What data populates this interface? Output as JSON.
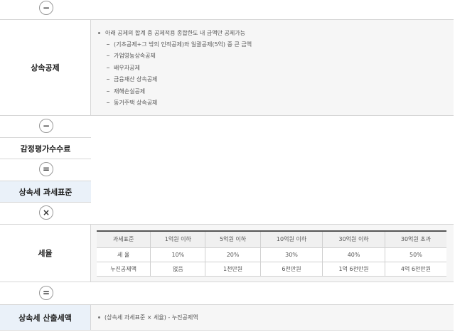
{
  "operators": {
    "minus1": "−",
    "minus2": "−",
    "equals1": "=",
    "times": "×",
    "equals2": "="
  },
  "inheritance_deduction": {
    "label": "상속공제",
    "main_bullet": "아래 공제의 합계 중 공제적용 종합한도 내 금액만 공제가능",
    "sub_items": [
      "(기초공제+그 밖의 인적공제)와 일괄공제(5억) 중 큰 금액",
      "가업영농상속공제",
      "배우자공제",
      "금융재산 상속공제",
      "재해손실공제",
      "동거주택 상속공제"
    ]
  },
  "appraisal_fee": {
    "label": "감정평가수수료"
  },
  "tax_base": {
    "label": "상속세 과세표준"
  },
  "tax_rate": {
    "label": "세율",
    "headers": [
      "과세표준",
      "1억원 이하",
      "5억원 이하",
      "10억원 이하",
      "30억원 이하",
      "30억원 초과"
    ],
    "rows": [
      [
        "세 율",
        "10%",
        "20%",
        "30%",
        "40%",
        "50%"
      ],
      [
        "누진공제액",
        "없음",
        "1천만원",
        "6천만원",
        "1억 6천만원",
        "4억 6천만원"
      ]
    ]
  },
  "calculated_tax": {
    "label": "상속세 산출세액",
    "formula": "(상속세 과세표준 × 세율) - 누진공제액"
  }
}
